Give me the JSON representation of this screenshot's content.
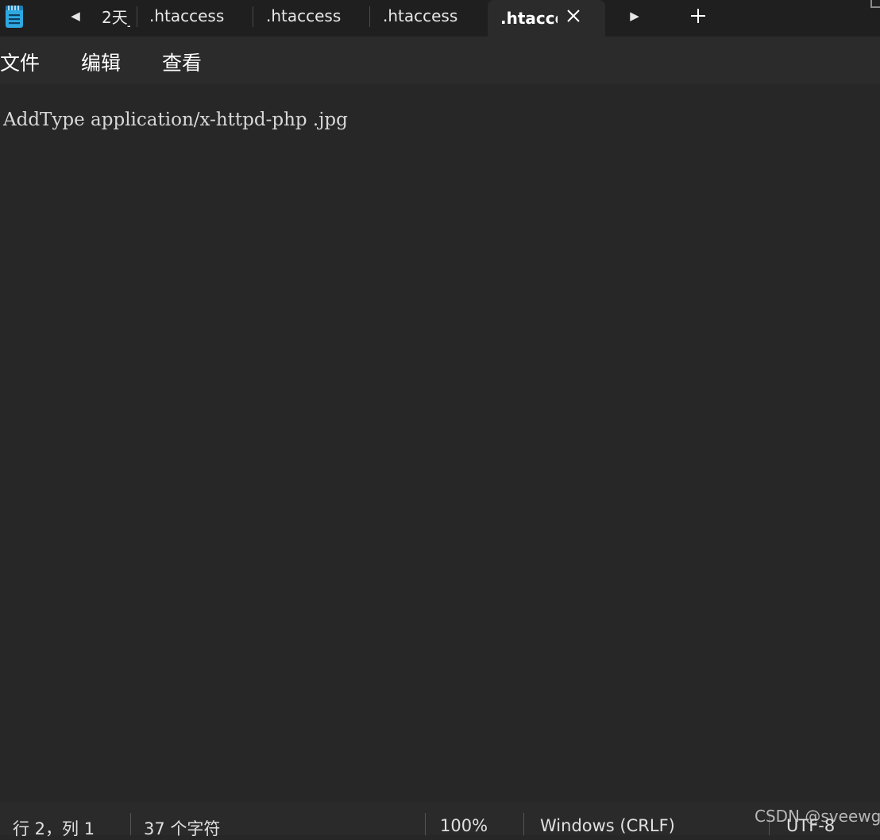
{
  "app": {
    "icon": "notepad-icon",
    "accent": "#2ea8e0"
  },
  "tabs": [
    {
      "label": "2天_",
      "active": false
    },
    {
      "label": ".htaccess",
      "active": false
    },
    {
      "label": ".htaccess",
      "active": false
    },
    {
      "label": ".htaccess",
      "active": false
    },
    {
      "label": ".htaccess",
      "active": true
    }
  ],
  "tab_controls": {
    "scroll_left_icon": "triangle-left-icon",
    "scroll_right_icon": "triangle-right-icon",
    "close_icon": "close-icon",
    "new_tab_icon": "plus-icon"
  },
  "menu": {
    "file": "文件",
    "edit": "编辑",
    "view": "查看"
  },
  "editor": {
    "content": "AddType application/x-httpd-php .jpg"
  },
  "status": {
    "position": "行 2，列 1",
    "char_count": "37 个字符",
    "zoom": "100%",
    "line_ending": "Windows (CRLF)",
    "encoding": "UTF-8"
  },
  "watermark": "CSDN @sveewg",
  "colors": {
    "tabbar_bg": "#1f1f1f",
    "active_tab_bg": "#2b2b2b",
    "editor_bg": "#272727",
    "text": "#ffffff"
  }
}
